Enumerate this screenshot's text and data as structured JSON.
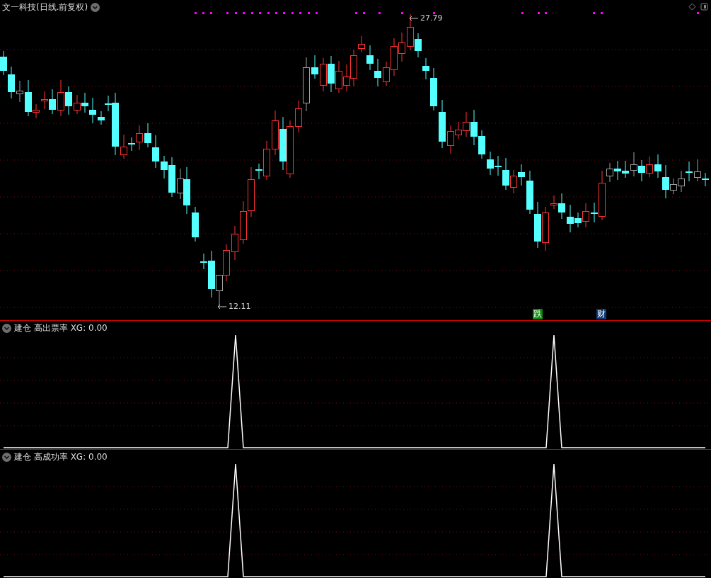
{
  "header": {
    "title": "文一科技(日线.前复权)"
  },
  "price_labels": [
    {
      "kind": "high",
      "text": "27.79"
    },
    {
      "kind": "low",
      "text": "12.11"
    }
  ],
  "event_badges": [
    {
      "text": "跌",
      "color": "#0a8a0a"
    },
    {
      "text": "财",
      "color": "#0d3a78"
    }
  ],
  "indicator_panels": [
    {
      "title": "建仓 高出票率 XG: 0.00"
    },
    {
      "title": "建仓 高成功率 XG: 0.00"
    }
  ]
}
